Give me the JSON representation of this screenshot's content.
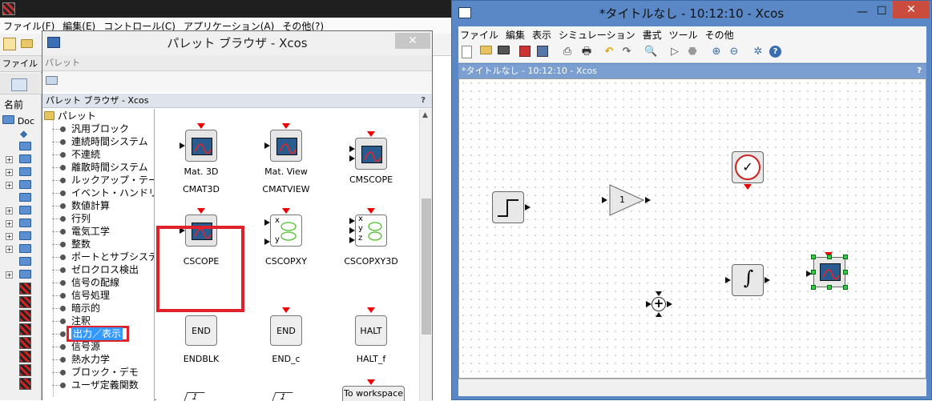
{
  "console": {
    "menu": [
      "ファイル(F)",
      "編集(E)",
      "コントロール(C)",
      "アプリケーション(A)",
      "その他(?)"
    ],
    "file_label": "ファイル",
    "name_header": "名前",
    "doc_label": "Doc"
  },
  "palette_window": {
    "title": "パレット ブラウザ - Xcos",
    "close_glyph": "✕",
    "header_label": "パレット",
    "panel_title": "パレット ブラウザ - Xcos",
    "help_glyph": "?",
    "tree_root": "パレット",
    "tree_items": [
      "汎用ブロック",
      "連続時間システム",
      "不連続",
      "離散時間システム",
      "ルックアップ・テーブル",
      "イベント・ハンドリング",
      "数値計算",
      "行列",
      "電気工学",
      "整数",
      "ポートとサブシステム",
      "ゼロクロス検出",
      "信号の配線",
      "信号処理",
      "暗示的",
      "注釈",
      "出力／表示",
      "信号源",
      "熱水力学",
      "ブロック・デモ",
      "ユーザ定義関数"
    ],
    "selected_tree_item": "出力／表示",
    "blocks": [
      {
        "inner": "Mat. 3D",
        "name": "CMAT3D"
      },
      {
        "inner": "Mat. View",
        "name": "CMATVIEW"
      },
      {
        "inner": "",
        "name": "CMSCOPE"
      },
      {
        "inner": "",
        "name": "CSCOPE"
      },
      {
        "inner": "",
        "name": "CSCOPXY"
      },
      {
        "inner": "",
        "name": "CSCOPXY3D"
      },
      {
        "inner": "END",
        "name": "ENDBLK"
      },
      {
        "inner": "END",
        "name": "END_c"
      },
      {
        "inner": "HALT",
        "name": "HALT_f"
      },
      {
        "inner": "To workspace",
        "name": ""
      }
    ],
    "selected_block": "CSCOPE",
    "xy_labels": [
      "x",
      "y",
      "z"
    ],
    "partial_label": "1"
  },
  "xcos_window": {
    "title": "*タイトルなし - 10:12:10 - Xcos",
    "tab_title": "*タイトルなし - 10:12:10 - Xcos",
    "help_glyph": "?",
    "menu": [
      "ファイル",
      "編集",
      "表示",
      "シミュレーション",
      "書式",
      "ツール",
      "その他"
    ],
    "controls": {
      "minimize": "—",
      "maximize": "☐",
      "close": "✕"
    },
    "gain_label": "1",
    "sum_label": "+",
    "integral_label": "∫",
    "clock_glyph": "✓"
  },
  "colors": {
    "selection_red": "#e0212b",
    "xcos_frame": "#5a87c5",
    "tree_selected": "#3399ff"
  }
}
